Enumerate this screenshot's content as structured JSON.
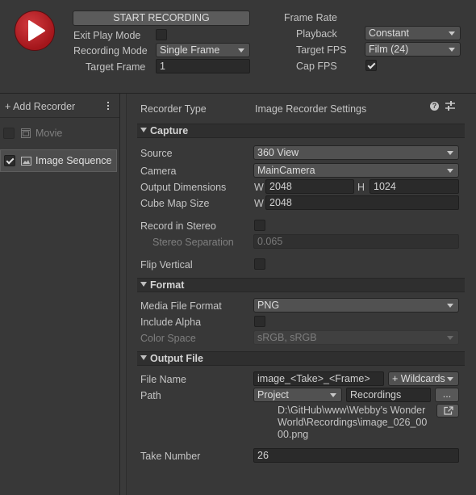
{
  "header": {
    "start_recording_label": "START RECORDING",
    "exit_play_mode_label": "Exit Play Mode",
    "exit_play_mode_checked": false,
    "recording_mode_label": "Recording Mode",
    "recording_mode_value": "Single Frame",
    "target_frame_label": "Target Frame",
    "target_frame_value": "1",
    "frame_rate_label": "Frame Rate",
    "playback_label": "Playback",
    "playback_value": "Constant",
    "target_fps_label": "Target FPS",
    "target_fps_value": "Film (24)",
    "cap_fps_label": "Cap FPS",
    "cap_fps_checked": true
  },
  "recorder_list": {
    "add_recorder_label": "+ Add Recorder",
    "items": [
      {
        "label": "Movie",
        "enabled": false,
        "selected": false,
        "icon": "film-icon"
      },
      {
        "label": "Image Sequence",
        "enabled": true,
        "selected": true,
        "icon": "image-icon"
      }
    ]
  },
  "settings": {
    "recorder_type_label": "Recorder Type",
    "recorder_type_value": "Image Recorder Settings",
    "capture": {
      "title": "Capture",
      "source_label": "Source",
      "source_value": "360 View",
      "camera_label": "Camera",
      "camera_value": "MainCamera",
      "output_dimensions_label": "Output Dimensions",
      "w_label": "W",
      "width_value": "2048",
      "h_label": "H",
      "height_value": "1024",
      "cube_map_size_label": "Cube Map Size",
      "cube_w_label": "W",
      "cube_map_value": "2048",
      "record_in_stereo_label": "Record in Stereo",
      "record_in_stereo_checked": false,
      "stereo_separation_label": "Stereo Separation",
      "stereo_separation_value": "0.065",
      "flip_vertical_label": "Flip Vertical",
      "flip_vertical_checked": false
    },
    "format": {
      "title": "Format",
      "media_file_format_label": "Media File Format",
      "media_file_format_value": "PNG",
      "include_alpha_label": "Include Alpha",
      "include_alpha_checked": false,
      "color_space_label": "Color Space",
      "color_space_value": "sRGB, sRGB"
    },
    "output_file": {
      "title": "Output File",
      "file_name_label": "File Name",
      "file_name_value": "image_<Take>_<Frame>",
      "wildcards_label": "+ Wildcards",
      "path_label": "Path",
      "path_root_value": "Project",
      "path_folder_value": "Recordings",
      "browse_label": "...",
      "full_path_line1": "D:\\GitHub\\www\\Webby's Wonder",
      "full_path_line2": "World\\Recordings\\image_026_00",
      "full_path_line3": "00.png",
      "take_number_label": "Take Number",
      "take_number_value": "26"
    }
  },
  "colors": {
    "background": "#383838",
    "record_button": "#b01f24",
    "selected_item": "#4d4d4d"
  }
}
